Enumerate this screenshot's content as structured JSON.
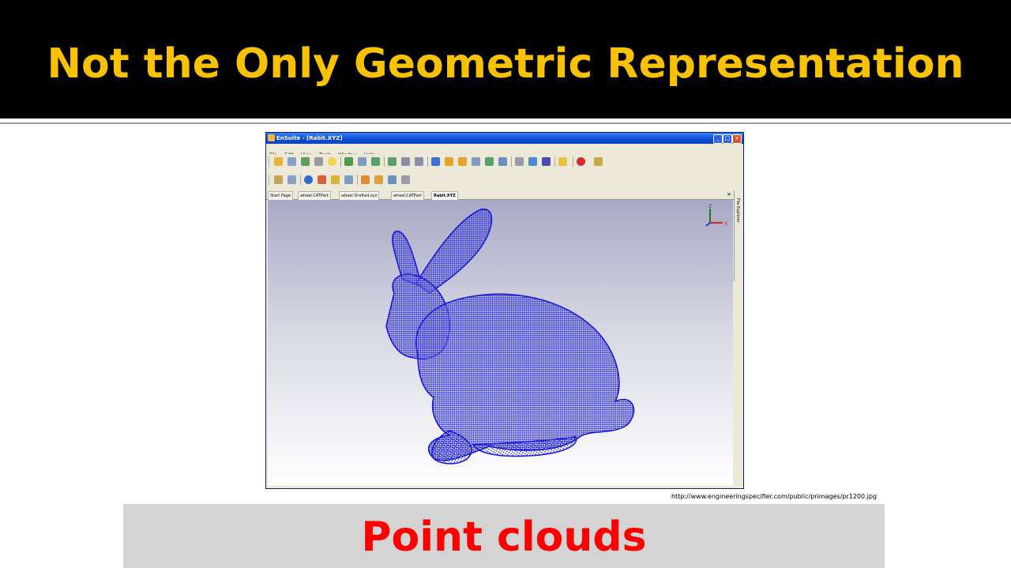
{
  "slide": {
    "title": "Not the Only Geometric Representation",
    "source_url": "http://www.engineeringspecifier.com/public/primages/pr1200.jpg",
    "caption": "Point clouds"
  },
  "window": {
    "title": "EnSuite - [Rabit.XYZ]",
    "menu": [
      "File",
      "Edit",
      "View",
      "Tools",
      "Window",
      "Help"
    ],
    "tabs": [
      "Start Page",
      "wheel.CATPart",
      "wheel Drafted.xyz",
      "wheel.CATPart",
      "Rabit.XYZ"
    ],
    "active_tab": "Rabit.XYZ",
    "side_panel_label": "File Explorer",
    "axis_labels": {
      "z": "Z",
      "x": "X"
    }
  },
  "colors": {
    "title": "#f9c200",
    "caption": "#ff0000",
    "point_cloud": "#1a1ad9"
  },
  "icons": [
    "open-icon",
    "save-icon",
    "print-icon",
    "help-icon",
    "zoom-icon",
    "select-icon",
    "pan-icon",
    "rotate-icon",
    "info-icon",
    "cube-icon"
  ]
}
